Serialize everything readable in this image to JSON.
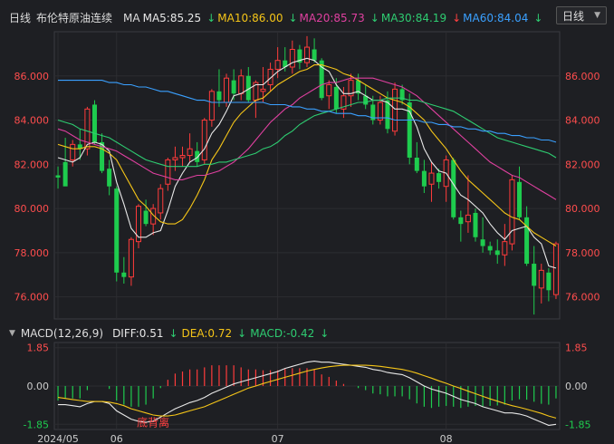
{
  "header": {
    "period": "日线",
    "instrument": "布伦特原油连续",
    "ma_label": "MA",
    "ma": [
      {
        "label": "MA5:85.25",
        "arrow": "↓",
        "arrow_color": "#2ecc71",
        "color": "#e8e8e8"
      },
      {
        "label": "MA10:86.00",
        "arrow": "↓",
        "arrow_color": "#2ecc71",
        "color": "#f5c518"
      },
      {
        "label": "MA20:85.73",
        "arrow": "↓",
        "arrow_color": "#2ecc71",
        "color": "#e040a0"
      },
      {
        "label": "MA30:84.19",
        "arrow": "↓",
        "arrow_color": "#2ecc71",
        "color": "#2ecc71"
      },
      {
        "label": "MA60:84.04",
        "arrow": "↑",
        "arrow_color": "#ff4040",
        "color": "#3aa0ff"
      },
      {
        "label": "",
        "arrow": "↓",
        "arrow_color": "#2ecc71",
        "color": "#ccc"
      }
    ],
    "period_select": "日线",
    "select_icon": "caret-down-icon"
  },
  "macd_header": {
    "collapse_icon": "collapse-caret-icon",
    "title": "MACD(12,26,9)",
    "diff": {
      "label": "DIFF:0.51",
      "arrow": "↓",
      "arrow_color": "#2ecc71",
      "color": "#e8e8e8"
    },
    "dea": {
      "label": "DEA:0.72",
      "arrow": "↓",
      "arrow_color": "#2ecc71",
      "color": "#f5c518"
    },
    "macd": {
      "label": "MACD:-0.42",
      "arrow": "↓",
      "arrow_color": "#2ecc71",
      "color": "#2ecc71"
    }
  },
  "chart_data": {
    "type": "candlestick",
    "y_ticks": [
      "86.000",
      "84.000",
      "82.000",
      "80.000",
      "78.000",
      "76.000"
    ],
    "y_tick_values": [
      86,
      84,
      82,
      80,
      78,
      76
    ],
    "y_ticks_left": [
      "86.000",
      "84.000",
      "82.000",
      "80.000",
      "78.000",
      "76.000"
    ],
    "ylim": [
      75,
      88
    ],
    "x_ticks": [
      {
        "label": "2024/05",
        "index": 0
      },
      {
        "label": "06",
        "index": 8
      },
      {
        "label": "07",
        "index": 30
      },
      {
        "label": "08",
        "index": 53
      }
    ],
    "annotation": {
      "text": "底背离",
      "index": 13,
      "value": -1.78,
      "color": "#ff4040"
    },
    "macd_ticks": [
      "1.85",
      "0.00",
      "-1.85"
    ],
    "macd_tick_values": [
      1.85,
      0,
      -1.85
    ],
    "macd_ylim": [
      -2.1,
      2.1
    ],
    "candles": [
      [
        81.5,
        81.9,
        80.9,
        81.4
      ],
      [
        82.1,
        83.2,
        81.7,
        81.0
      ],
      [
        82.2,
        83.1,
        81.9,
        82.9
      ],
      [
        82.9,
        83.6,
        82.2,
        82.7
      ],
      [
        82.7,
        84.6,
        82.4,
        84.5
      ],
      [
        84.7,
        84.9,
        82.9,
        83.0
      ],
      [
        83.0,
        83.4,
        81.6,
        81.7
      ],
      [
        81.8,
        82.2,
        80.6,
        81.0
      ],
      [
        80.9,
        81.0,
        76.7,
        77.1
      ],
      [
        77.1,
        77.8,
        76.6,
        76.9
      ],
      [
        76.9,
        78.7,
        76.5,
        78.6
      ],
      [
        78.5,
        80.2,
        78.2,
        80.1
      ],
      [
        79.9,
        80.4,
        79.2,
        79.3
      ],
      [
        79.3,
        80.2,
        78.8,
        80.0
      ],
      [
        79.8,
        81.1,
        79.5,
        80.9
      ],
      [
        81.1,
        82.3,
        80.8,
        82.2
      ],
      [
        82.2,
        82.8,
        81.7,
        82.3
      ],
      [
        82.3,
        82.8,
        81.9,
        82.4
      ],
      [
        82.4,
        83.4,
        82.1,
        82.7
      ],
      [
        82.6,
        83.0,
        81.9,
        82.1
      ],
      [
        82.2,
        84.1,
        82.0,
        84.0
      ],
      [
        84.0,
        85.4,
        83.7,
        85.3
      ],
      [
        85.3,
        86.3,
        84.6,
        84.9
      ],
      [
        84.8,
        86.1,
        84.6,
        85.9
      ],
      [
        85.8,
        86.3,
        84.9,
        85.2
      ],
      [
        85.2,
        86.3,
        84.9,
        86.0
      ],
      [
        86.0,
        86.4,
        84.8,
        84.9
      ],
      [
        84.9,
        85.8,
        84.1,
        85.7
      ],
      [
        85.3,
        86.4,
        84.8,
        85.4
      ],
      [
        85.6,
        86.6,
        85.3,
        86.3
      ],
      [
        86.3,
        87.3,
        85.9,
        86.7
      ],
      [
        86.7,
        87.3,
        86.2,
        86.4
      ],
      [
        86.4,
        87.6,
        86.1,
        87.2
      ],
      [
        87.2,
        87.4,
        86.3,
        86.6
      ],
      [
        86.6,
        87.8,
        86.4,
        87.3
      ],
      [
        87.2,
        87.7,
        86.6,
        86.7
      ],
      [
        86.7,
        86.8,
        84.9,
        85.0
      ],
      [
        85.1,
        85.8,
        84.5,
        85.6
      ],
      [
        85.5,
        85.9,
        84.3,
        84.5
      ],
      [
        84.5,
        85.5,
        84.1,
        85.1
      ],
      [
        85.1,
        86.1,
        84.6,
        85.8
      ],
      [
        85.8,
        86.1,
        84.9,
        85.2
      ],
      [
        85.1,
        85.6,
        84.5,
        84.7
      ],
      [
        84.7,
        85.1,
        83.8,
        84.0
      ],
      [
        84.0,
        85.1,
        83.8,
        84.8
      ],
      [
        84.9,
        85.3,
        83.4,
        83.6
      ],
      [
        83.5,
        85.7,
        83.3,
        85.4
      ],
      [
        85.4,
        85.6,
        84.7,
        84.9
      ],
      [
        84.8,
        85.2,
        82.0,
        82.3
      ],
      [
        82.3,
        83.0,
        81.6,
        81.7
      ],
      [
        81.7,
        82.2,
        80.7,
        81.0
      ],
      [
        81.1,
        82.1,
        80.3,
        81.6
      ],
      [
        81.6,
        81.8,
        80.9,
        81.2
      ],
      [
        81.0,
        82.4,
        80.3,
        82.2
      ],
      [
        82.2,
        82.3,
        79.5,
        79.6
      ],
      [
        79.6,
        79.9,
        78.5,
        79.3
      ],
      [
        79.4,
        81.5,
        78.9,
        79.7
      ],
      [
        79.8,
        80.0,
        78.5,
        78.7
      ],
      [
        78.6,
        79.6,
        78.0,
        78.3
      ],
      [
        78.3,
        78.5,
        77.9,
        78.1
      ],
      [
        78.1,
        78.6,
        77.5,
        77.9
      ],
      [
        77.9,
        79.3,
        77.4,
        78.5
      ],
      [
        78.4,
        81.5,
        78.1,
        81.3
      ],
      [
        81.2,
        81.9,
        79.5,
        79.6
      ],
      [
        79.6,
        80.1,
        77.4,
        77.5
      ],
      [
        77.5,
        78.3,
        75.2,
        76.5
      ],
      [
        76.4,
        77.5,
        75.7,
        77.2
      ],
      [
        77.1,
        77.3,
        75.8,
        76.3
      ],
      [
        76.1,
        78.5,
        75.9,
        78.4
      ]
    ],
    "series": [
      {
        "name": "MA5",
        "color": "#e8e8e8",
        "values": [
          82.3,
          82.2,
          82.1,
          82.3,
          82.9,
          83.0,
          82.9,
          82.6,
          81.2,
          80.2,
          79.1,
          78.7,
          78.7,
          78.9,
          79.0,
          79.9,
          81.0,
          81.6,
          82.1,
          82.3,
          82.7,
          83.4,
          83.8,
          84.4,
          85.1,
          85.2,
          85.4,
          85.6,
          85.6,
          85.9,
          86.2,
          86.4,
          86.6,
          86.7,
          86.8,
          86.7,
          86.4,
          86.2,
          85.6,
          85.2,
          85.2,
          85.3,
          85.1,
          84.9,
          84.9,
          84.8,
          84.5,
          84.5,
          84.4,
          83.7,
          82.7,
          82.1,
          81.7,
          81.6,
          81.1,
          80.6,
          80.4,
          80.1,
          79.8,
          79.3,
          78.9,
          78.6,
          79.0,
          79.1,
          79.2,
          78.7,
          78.4,
          77.4,
          77.3
        ]
      },
      {
        "name": "MA10",
        "color": "#f5c518",
        "values": [
          82.9,
          82.8,
          82.7,
          82.7,
          82.8,
          82.8,
          82.7,
          82.5,
          82.2,
          81.6,
          81.0,
          80.4,
          80.1,
          79.7,
          79.4,
          79.3,
          79.3,
          79.5,
          80.0,
          80.6,
          81.3,
          82.2,
          82.7,
          83.3,
          83.9,
          84.3,
          84.6,
          84.9,
          85.0,
          85.3,
          85.6,
          85.8,
          86.0,
          86.2,
          86.3,
          86.5,
          86.5,
          86.4,
          86.3,
          86.1,
          86.0,
          85.8,
          85.6,
          85.4,
          85.2,
          85.0,
          84.9,
          84.8,
          84.6,
          84.3,
          84.0,
          83.5,
          83.1,
          82.7,
          82.2,
          81.7,
          81.3,
          81.0,
          80.7,
          80.4,
          80.1,
          79.8,
          79.6,
          79.5,
          79.2,
          78.9,
          78.7,
          78.5,
          78.3
        ]
      },
      {
        "name": "MA20",
        "color": "#e040a0",
        "values": [
          83.6,
          83.5,
          83.3,
          83.1,
          83.0,
          82.9,
          82.8,
          82.7,
          82.6,
          82.4,
          82.2,
          82.0,
          81.8,
          81.6,
          81.5,
          81.4,
          81.3,
          81.3,
          81.4,
          81.5,
          81.5,
          81.6,
          81.7,
          81.9,
          82.1,
          82.4,
          82.7,
          83.1,
          83.5,
          83.9,
          84.2,
          84.5,
          84.7,
          85.0,
          85.2,
          85.4,
          85.6,
          85.7,
          85.7,
          85.8,
          85.9,
          85.9,
          85.9,
          85.9,
          85.8,
          85.7,
          85.6,
          85.5,
          85.3,
          85.1,
          84.8,
          84.5,
          84.2,
          83.9,
          83.6,
          83.3,
          83.0,
          82.7,
          82.4,
          82.1,
          81.9,
          81.7,
          81.5,
          81.4,
          81.2,
          81.0,
          80.8,
          80.6,
          80.4
        ]
      },
      {
        "name": "MA30",
        "color": "#2ecc71",
        "values": [
          84.0,
          83.9,
          83.8,
          83.6,
          83.5,
          83.4,
          83.3,
          83.2,
          83.0,
          82.8,
          82.6,
          82.4,
          82.2,
          82.1,
          82.0,
          81.9,
          81.9,
          81.9,
          81.9,
          81.9,
          82.0,
          82.0,
          82.1,
          82.1,
          82.2,
          82.3,
          82.4,
          82.5,
          82.7,
          82.8,
          83.0,
          83.3,
          83.5,
          83.8,
          84.0,
          84.2,
          84.3,
          84.4,
          84.5,
          84.6,
          84.7,
          84.8,
          84.8,
          84.9,
          84.9,
          85.0,
          85.0,
          85.0,
          84.9,
          84.9,
          84.8,
          84.7,
          84.6,
          84.5,
          84.4,
          84.2,
          84.0,
          83.8,
          83.6,
          83.4,
          83.2,
          83.1,
          83.0,
          82.9,
          82.8,
          82.7,
          82.6,
          82.5,
          82.3
        ]
      },
      {
        "name": "MA60",
        "color": "#3aa0ff",
        "values": [
          85.8,
          85.8,
          85.8,
          85.8,
          85.8,
          85.8,
          85.8,
          85.7,
          85.7,
          85.6,
          85.6,
          85.5,
          85.5,
          85.4,
          85.3,
          85.3,
          85.2,
          85.1,
          85.0,
          84.9,
          84.9,
          84.8,
          84.8,
          84.8,
          84.8,
          84.8,
          84.8,
          84.8,
          84.8,
          84.7,
          84.7,
          84.7,
          84.6,
          84.6,
          84.5,
          84.5,
          84.4,
          84.4,
          84.3,
          84.3,
          84.3,
          84.2,
          84.2,
          84.1,
          84.1,
          84.1,
          84.0,
          84.0,
          84.0,
          84.0,
          83.9,
          83.9,
          83.8,
          83.8,
          83.7,
          83.7,
          83.6,
          83.6,
          83.5,
          83.5,
          83.4,
          83.4,
          83.3,
          83.3,
          83.2,
          83.2,
          83.1,
          83.1,
          83.0
        ]
      }
    ],
    "macd": {
      "diff": [
        -0.9,
        -0.9,
        -0.95,
        -1.0,
        -0.85,
        -0.75,
        -0.75,
        -0.85,
        -1.2,
        -1.4,
        -1.6,
        -1.7,
        -1.75,
        -1.7,
        -1.5,
        -1.3,
        -1.1,
        -0.95,
        -0.8,
        -0.7,
        -0.55,
        -0.35,
        -0.2,
        -0.05,
        0.1,
        0.2,
        0.3,
        0.4,
        0.5,
        0.6,
        0.7,
        0.85,
        0.95,
        1.05,
        1.15,
        1.2,
        1.15,
        1.15,
        1.1,
        1.05,
        1.0,
        0.95,
        0.9,
        0.8,
        0.75,
        0.65,
        0.6,
        0.55,
        0.4,
        0.2,
        0.0,
        -0.15,
        -0.25,
        -0.35,
        -0.5,
        -0.65,
        -0.75,
        -0.85,
        -1.0,
        -1.1,
        -1.2,
        -1.3,
        -1.3,
        -1.35,
        -1.45,
        -1.6,
        -1.75,
        -1.9,
        -1.85
      ],
      "dea": [
        -0.55,
        -0.6,
        -0.65,
        -0.7,
        -0.75,
        -0.75,
        -0.75,
        -0.78,
        -0.85,
        -0.95,
        -1.1,
        -1.2,
        -1.3,
        -1.4,
        -1.45,
        -1.45,
        -1.4,
        -1.3,
        -1.2,
        -1.1,
        -1.0,
        -0.85,
        -0.7,
        -0.55,
        -0.4,
        -0.25,
        -0.1,
        0.0,
        0.12,
        0.22,
        0.32,
        0.42,
        0.52,
        0.62,
        0.72,
        0.8,
        0.87,
        0.93,
        0.97,
        1.0,
        1.0,
        1.0,
        1.0,
        0.98,
        0.95,
        0.9,
        0.85,
        0.8,
        0.72,
        0.62,
        0.5,
        0.38,
        0.25,
        0.13,
        0.0,
        -0.12,
        -0.25,
        -0.37,
        -0.5,
        -0.62,
        -0.73,
        -0.85,
        -0.95,
        -1.03,
        -1.12,
        -1.22,
        -1.32,
        -1.45,
        -1.55
      ],
      "hist": [
        -0.7,
        -0.6,
        -0.6,
        -0.6,
        -0.2,
        0.0,
        0.0,
        -0.14,
        -0.7,
        -0.9,
        -1.0,
        -1.0,
        -0.9,
        -0.6,
        -0.1,
        0.3,
        0.6,
        0.7,
        0.8,
        0.8,
        0.9,
        1.0,
        1.0,
        1.0,
        1.0,
        0.9,
        0.8,
        0.8,
        0.76,
        0.76,
        0.76,
        0.86,
        0.86,
        0.86,
        0.86,
        0.8,
        0.56,
        0.44,
        0.26,
        0.1,
        0.0,
        -0.1,
        -0.2,
        -0.36,
        -0.4,
        -0.5,
        -0.5,
        -0.5,
        -0.64,
        -0.84,
        -1.0,
        -1.06,
        -1.0,
        -0.96,
        -1.0,
        -1.06,
        -1.0,
        -0.96,
        -1.0,
        -0.96,
        -0.94,
        -0.9,
        -0.7,
        -0.64,
        -0.66,
        -0.76,
        -0.86,
        -0.9,
        -0.6
      ]
    }
  }
}
